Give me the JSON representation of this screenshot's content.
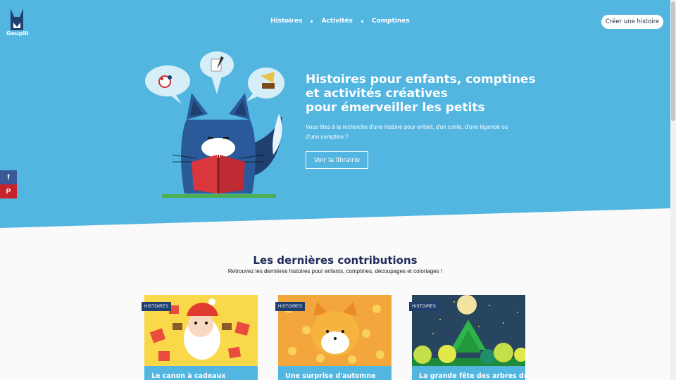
{
  "header": {
    "logo_text": "Goupili",
    "nav": [
      {
        "label": "Histoires"
      },
      {
        "label": "Activités"
      },
      {
        "label": "Comptines"
      }
    ],
    "cta_label": "Créer une histoire"
  },
  "share": {
    "facebook_glyph": "f",
    "pinterest_glyph": "P"
  },
  "hero": {
    "title_lines": [
      "Histoires pour enfants, comptines",
      "et activités créatives",
      "pour émerveiller les petits"
    ],
    "subtitle": "Vous êtes à la recherche d'une histoire pour enfant, d'un conte, d'une légende ou d'une comptine ?",
    "button_label": "Voir la librairie"
  },
  "section": {
    "title": "Les dernières contributions",
    "subtitle": "Retrouvez les dernières histoires pour enfants, comptines, découpages et coloriages !"
  },
  "cards": [
    {
      "tag": "HISTOIRES",
      "title": "Le canon à cadeaux"
    },
    {
      "tag": "HISTOIRES",
      "title": "Une surprise d'automne"
    },
    {
      "tag": "HISTOIRES",
      "title": "La grande fête des arbres de la"
    }
  ],
  "colors": {
    "hero_blue": "#52b6e1",
    "navy": "#1f2a5a",
    "tag_bg": "#1f3f6e"
  }
}
